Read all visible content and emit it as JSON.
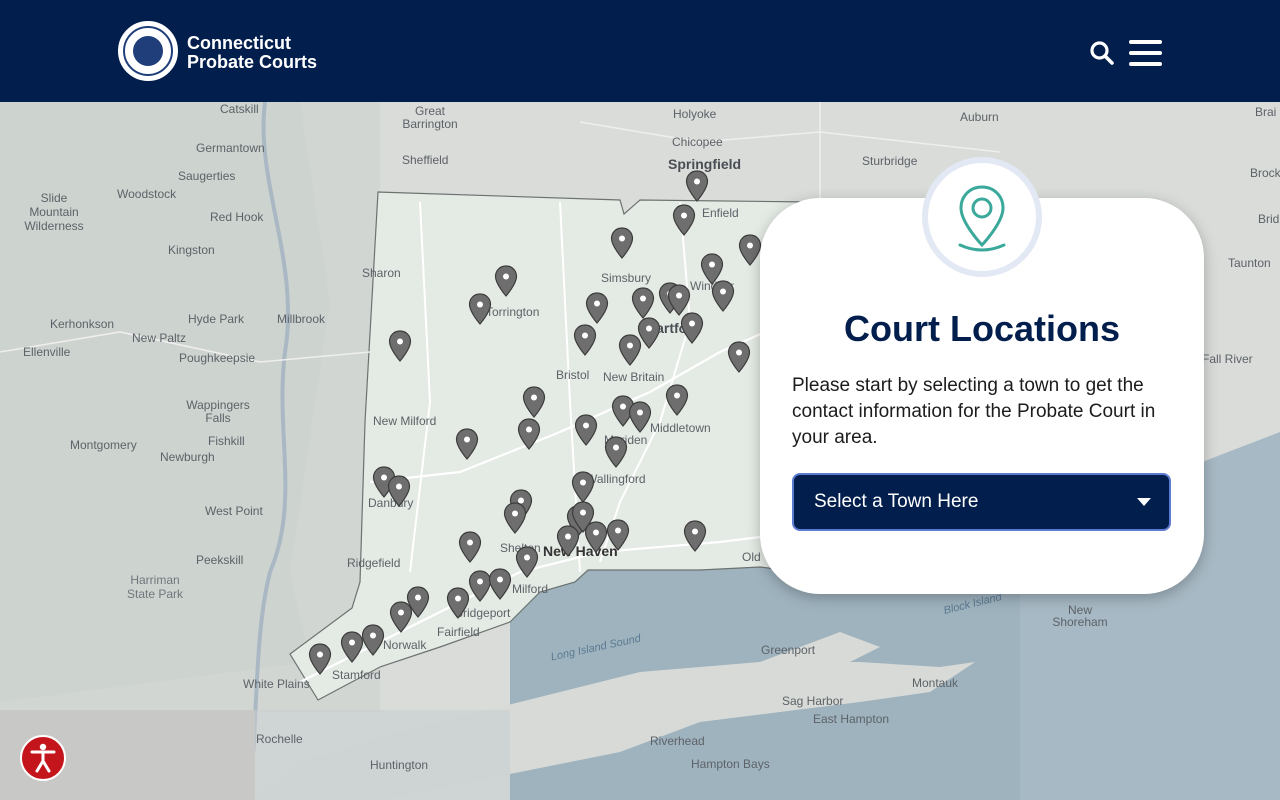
{
  "header": {
    "brand_line1": "Connecticut",
    "brand_line2": "Probate Courts",
    "logo_icon": "state-seal-icon",
    "search_icon": "search-icon",
    "menu_icon": "hamburger-icon"
  },
  "card": {
    "title": "Court Locations",
    "description": "Please start by selecting a town to get the contact information for the Probate Court in your area.",
    "select_label": "Select a Town Here",
    "icon": "location-pin-icon"
  },
  "map": {
    "places": [
      "Catskill",
      "Great Barrington",
      "Holyoke",
      "Chicopee",
      "Springfield",
      "Auburn",
      "Sturbridge",
      "Germantown",
      "Saugerties",
      "Sheffield",
      "Slide Mountain Wilderness",
      "Woodstock",
      "Red Hook",
      "Enfield",
      "Kingston",
      "Sharon",
      "Simsbury",
      "Windsor",
      "Torrington",
      "Millbrook",
      "Hyde Park",
      "Kerhonkson",
      "New Paltz",
      "Poughkeepsie",
      "Ellenville",
      "Hartford",
      "Bristol",
      "New Britain",
      "Wappingers Falls",
      "Fishkill",
      "New Milford",
      "Meriden",
      "Middletown",
      "Montgomery",
      "Newburgh",
      "Danbury",
      "Wallingford",
      "Meriden",
      "West Point",
      "Peekskill",
      "Shelton",
      "New Haven",
      "Old",
      "Ridgefield",
      "Milford",
      "Harriman State Park",
      "Bridgeport",
      "Fairfield",
      "Norwalk",
      "Stamford",
      "White Plains",
      "Rochelle",
      "Huntington",
      "Riverhead",
      "Hampton Bays",
      "Greenport",
      "Sag Harbor",
      "East Hampton",
      "Montauk",
      "New Shoreham",
      "Taunton",
      "Fall River",
      "Long Island Sound",
      "Block Island",
      "Brai",
      "Brock",
      "Brid"
    ],
    "pin_icon": "map-pin-icon"
  },
  "accessibility": {
    "icon": "accessibility-icon"
  },
  "colors": {
    "header_bg": "#021e4c",
    "title": "#021e4c",
    "select_bg": "#021e4c",
    "pin_teal": "#3aa89a",
    "a11y": "#c4151c"
  }
}
